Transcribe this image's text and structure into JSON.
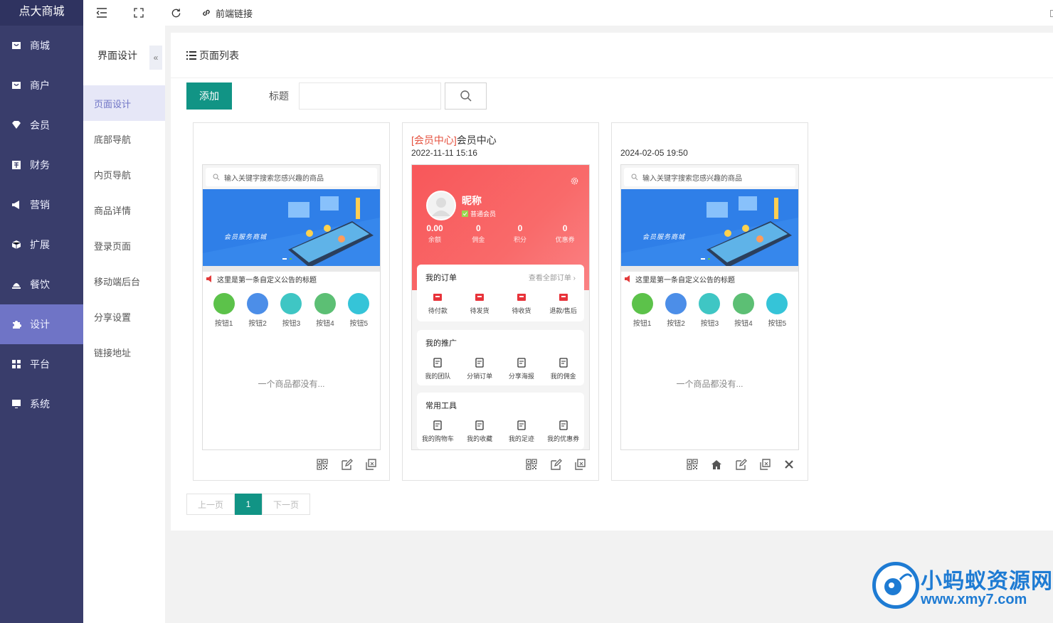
{
  "app": {
    "title": "点大商城"
  },
  "sidebar": {
    "items": [
      {
        "label": "商城",
        "icon": "mall-icon"
      },
      {
        "label": "商户",
        "icon": "merchant-icon"
      },
      {
        "label": "会员",
        "icon": "member-icon"
      },
      {
        "label": "财务",
        "icon": "finance-icon"
      },
      {
        "label": "营销",
        "icon": "megaphone-icon"
      },
      {
        "label": "扩展",
        "icon": "cube-icon"
      },
      {
        "label": "餐饮",
        "icon": "dining-icon"
      },
      {
        "label": "设计",
        "icon": "puzzle-icon",
        "active": true
      },
      {
        "label": "平台",
        "icon": "grid-icon"
      },
      {
        "label": "系统",
        "icon": "monitor-icon"
      }
    ]
  },
  "topbar": {
    "frontend_link": "前端链接"
  },
  "submenu": {
    "title": "界面设计",
    "items": [
      {
        "label": "页面设计",
        "active": true
      },
      {
        "label": "底部导航"
      },
      {
        "label": "内页导航"
      },
      {
        "label": "商品详情"
      },
      {
        "label": "登录页面"
      },
      {
        "label": "移动端后台"
      },
      {
        "label": "分享设置"
      },
      {
        "label": "链接地址"
      }
    ]
  },
  "panel": {
    "title": "页面列表",
    "add_label": "添加",
    "filter_label": "标题",
    "filter_value": "",
    "filter_placeholder": ""
  },
  "cards": [
    {
      "title_tag": "",
      "title": "",
      "time": "",
      "preview": "shop",
      "actions": [
        "qrcode-icon",
        "edit-icon",
        "copy-icon"
      ]
    },
    {
      "title_tag": "[会员中心]",
      "title": "会员中心",
      "time": "2022-11-11 15:16",
      "preview": "member",
      "actions": [
        "qrcode-icon",
        "edit-icon",
        "copy-icon"
      ]
    },
    {
      "title_tag": "",
      "title": "",
      "time": "2024-02-05 19:50",
      "preview": "shop",
      "actions": [
        "qrcode-icon",
        "home-icon",
        "edit-icon",
        "copy-icon",
        "close-icon"
      ]
    }
  ],
  "shop_preview": {
    "search_placeholder": "输入关键字搜索您感兴趣的商品",
    "banner_text": "会员服务商城",
    "notice": "这里是第一条自定义公告的标题",
    "buttons": [
      {
        "label": "按钮1",
        "color": "#5cc24a"
      },
      {
        "label": "按钮2",
        "color": "#4c8ee8"
      },
      {
        "label": "按钮3",
        "color": "#3fc6c4"
      },
      {
        "label": "按钮4",
        "color": "#5cbf74"
      },
      {
        "label": "按钮5",
        "color": "#35c4d8"
      }
    ],
    "empty_text": "一个商品都没有..."
  },
  "member_preview": {
    "nickname": "昵称",
    "level": "普通会员",
    "stats": [
      {
        "value": "0.00",
        "label": "余额"
      },
      {
        "value": "0",
        "label": "佣金"
      },
      {
        "value": "0",
        "label": "积分"
      },
      {
        "value": "0",
        "label": "优惠券"
      }
    ],
    "orders": {
      "title": "我的订单",
      "more": "查看全部订单",
      "items": [
        "待付款",
        "待发货",
        "待收货",
        "退款/售后"
      ]
    },
    "promo": {
      "title": "我的推广",
      "items": [
        "我的团队",
        "分销订单",
        "分享海报",
        "我的佣金"
      ]
    },
    "tools": {
      "title": "常用工具",
      "items": [
        "我的购物车",
        "我的收藏",
        "我的足迹",
        "我的优惠券"
      ]
    }
  },
  "pagination": {
    "prev": "上一页",
    "current": "1",
    "next": "下一页"
  },
  "watermark": {
    "text": "小蚂蚁资源网",
    "url": "www.xmy7.com"
  },
  "colors": {
    "sidebar": "#393d6b",
    "active": "#6f74c6",
    "primary": "#119485",
    "accent_red": "#f8575a"
  }
}
